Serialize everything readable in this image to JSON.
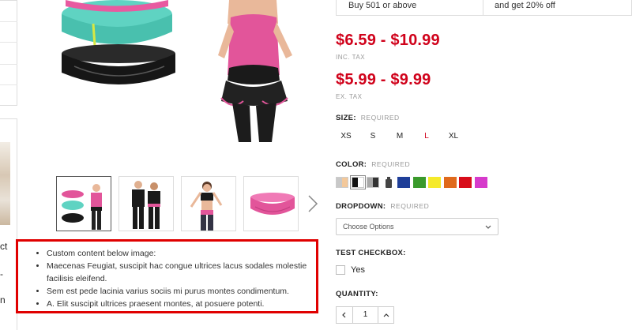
{
  "sidebar": {
    "partial_text_1": "ct",
    "partial_text_2": "-",
    "partial_text_3": "n"
  },
  "bulk_pricing": {
    "quantity": "Buy 501 or above",
    "discount": "and get 20% off"
  },
  "prices": {
    "inc_tax": "$6.59 - $10.99",
    "inc_tax_label": "INC. TAX",
    "ex_tax": "$5.99 - $9.99",
    "ex_tax_label": "EX. TAX"
  },
  "size": {
    "label": "SIZE:",
    "required": "REQUIRED",
    "options": [
      "XS",
      "S",
      "M",
      "L",
      "XL"
    ],
    "option_colors": [
      "#222222",
      "#222222",
      "#222222",
      "#d0021b",
      "#222222"
    ]
  },
  "color": {
    "label": "COLOR:",
    "required": "REQUIRED",
    "swatches": [
      {
        "name": "gray-peach",
        "colors": [
          "#c8c8c8",
          "#f3c89a"
        ]
      },
      {
        "name": "black-white",
        "colors": [
          "#111111",
          "#ffffff"
        ]
      },
      {
        "name": "gray-black",
        "colors": [
          "#a8a8a8",
          "#333333"
        ]
      },
      {
        "name": "bottle-icon",
        "colors": [
          "#444444"
        ]
      },
      {
        "name": "blue",
        "colors": [
          "#1f3f99"
        ]
      },
      {
        "name": "green",
        "colors": [
          "#3a9a2c"
        ]
      },
      {
        "name": "yellow",
        "colors": [
          "#f5ea2a"
        ]
      },
      {
        "name": "orange",
        "colors": [
          "#e06a1c"
        ]
      },
      {
        "name": "red",
        "colors": [
          "#d80d1a"
        ]
      },
      {
        "name": "magenta",
        "colors": [
          "#d63acb"
        ]
      }
    ]
  },
  "dropdown": {
    "label": "DROPDOWN:",
    "required": "REQUIRED",
    "selected": "Choose Options"
  },
  "test_checkbox": {
    "label": "TEST CHECKBOX:",
    "option": "Yes"
  },
  "quantity": {
    "label": "QUANTITY:",
    "value": "1",
    "decrement": "‹",
    "increment": "›"
  },
  "custom_content": {
    "items": [
      "Custom content below image:",
      "Maecenas Feugiat, suscipit hac congue ultrices lacus sodales molestie facilisis eleifend.",
      "Sem est pede lacinia varius sociis mi purus montes condimentum.",
      "A. Elit suscipit ultrices praesent montes, at posuere potenti."
    ],
    "highlight_color": "#e00000"
  }
}
